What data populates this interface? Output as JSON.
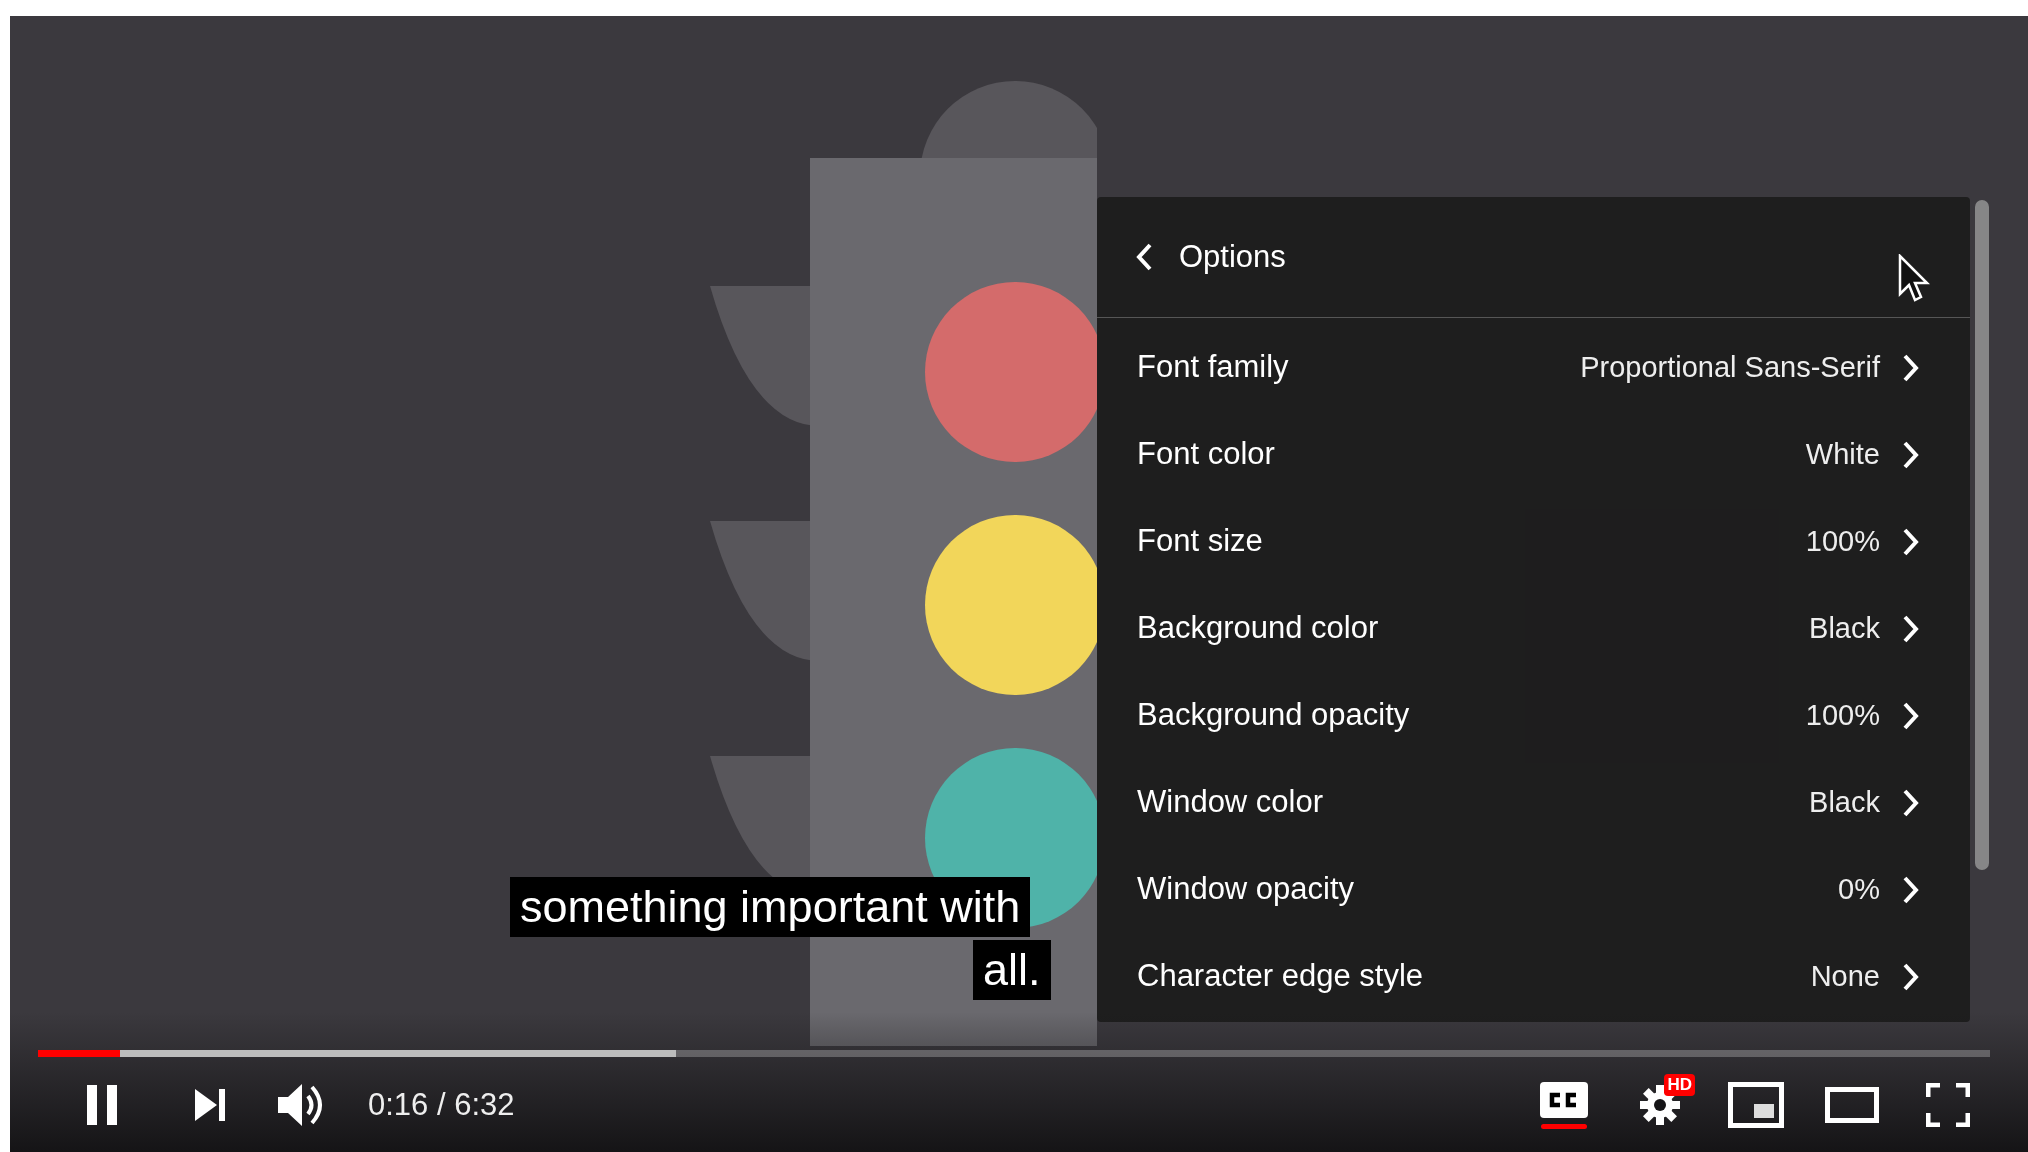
{
  "player": {
    "captions": [
      "something important with",
      "all."
    ],
    "menu": {
      "title": "Options",
      "items": [
        {
          "label": "Font family",
          "value": "Proportional Sans-Serif"
        },
        {
          "label": "Font color",
          "value": "White"
        },
        {
          "label": "Font size",
          "value": "100%"
        },
        {
          "label": "Background color",
          "value": "Black"
        },
        {
          "label": "Background opacity",
          "value": "100%"
        },
        {
          "label": "Window color",
          "value": "Black"
        },
        {
          "label": "Window opacity",
          "value": "0%"
        },
        {
          "label": "Character edge style",
          "value": "None"
        }
      ]
    },
    "progress": {
      "level": 0.042,
      "buffered": {
        "level": 0.327
      }
    },
    "controls": {
      "playing": true,
      "time": "0:16 / 6:32",
      "captions_on": true,
      "quality_badge": "HD"
    }
  }
}
